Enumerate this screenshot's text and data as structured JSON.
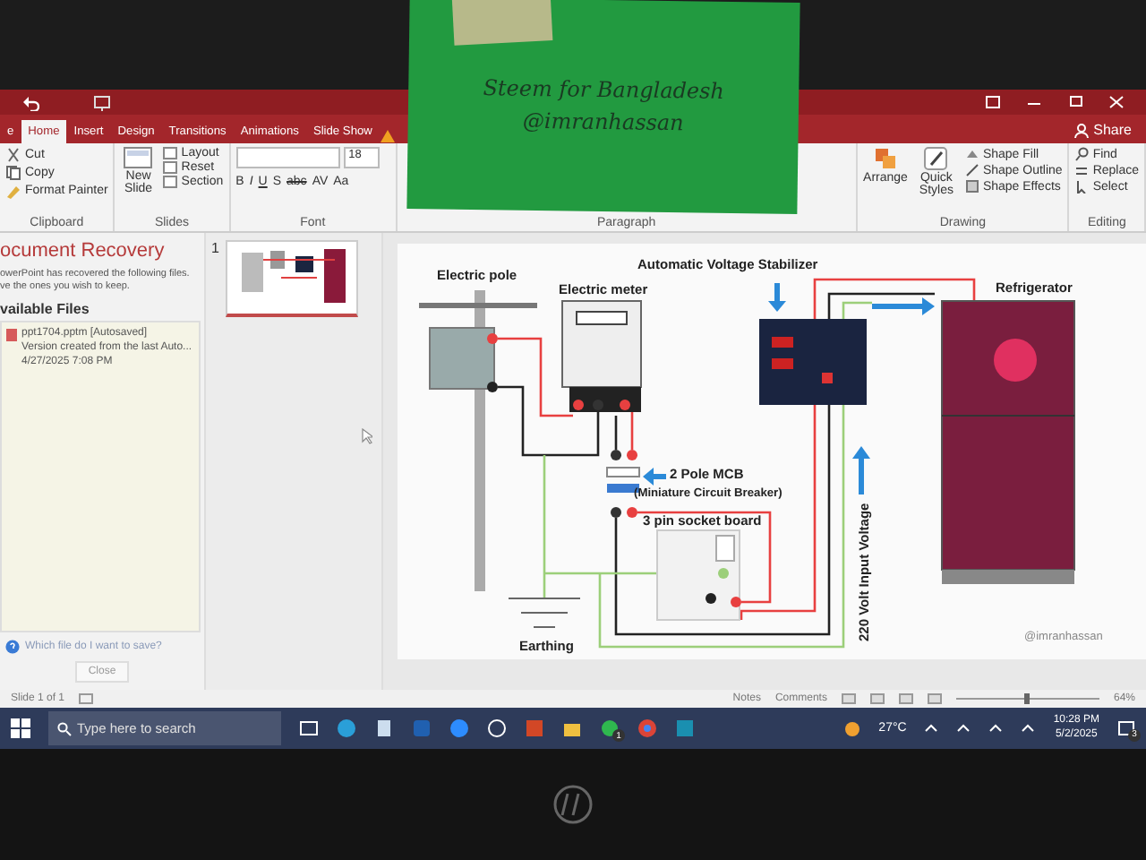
{
  "note": {
    "line_1": "Steem for Bangladesh",
    "line_2": "@imranhassan"
  },
  "ribbon": {
    "tabs": [
      {
        "label": "e",
        "selected": false
      },
      {
        "label": "Home",
        "selected": true
      },
      {
        "label": "Insert",
        "selected": false
      },
      {
        "label": "Design",
        "selected": false
      },
      {
        "label": "Transitions",
        "selected": false
      },
      {
        "label": "Animations",
        "selected": false
      },
      {
        "label": "Slide Show",
        "selected": false
      }
    ],
    "share": "Share",
    "clipboard": {
      "items": [
        "Cut",
        "Copy",
        "Format Painter"
      ],
      "label": "Clipboard"
    },
    "slides": {
      "new_slide": "New Slide",
      "items": [
        "Layout",
        "Reset",
        "Section"
      ],
      "label": "Slides"
    },
    "font": {
      "size": "18",
      "buttons": [
        "B",
        "I",
        "U",
        "S",
        "abc",
        "AV",
        "Aa"
      ],
      "label": "Font"
    },
    "paragraph": {
      "label": "Paragraph"
    },
    "drawing": {
      "arrange": "Arrange",
      "quick_styles": "Quick Styles",
      "items": [
        "Shape Fill",
        "Shape Outline",
        "Shape Effects"
      ],
      "label": "Drawing"
    },
    "editing": {
      "items": [
        "Find",
        "Replace",
        "Select"
      ],
      "label": "Editing"
    }
  },
  "recovery": {
    "title": "ocument Recovery",
    "message": [
      "owerPoint has recovered the following files.",
      "ve the ones you wish to keep."
    ],
    "heading": "vailable Files",
    "files": [
      {
        "name": "ppt1704.pptm  [Autosaved]",
        "detail": "Version created from the last Auto...",
        "date": "4/27/2025 7:08 PM"
      }
    ],
    "help_link": "Which file do I want to save?",
    "close": "Close"
  },
  "thumbnails": [
    {
      "number": "1",
      "selected": true
    }
  ],
  "slide": {
    "pole_label": "Electric pole",
    "meter_label": "Electric meter",
    "stabilizer_label": "Automatic Voltage Stabilizer",
    "refrigerator_label": "Refrigerator",
    "mcb_label": "2 Pole MCB",
    "mcb_note": "(Miniature Circuit Breaker)",
    "socket_label": "3 pin socket board",
    "earthing_label": "Earthing",
    "input_voltage_label": "220 Volt Input Voltage",
    "credit": "@imranhassan"
  },
  "status_bar": {
    "slide_count": "Slide 1 of 1",
    "notes": "Notes",
    "comments": "Comments",
    "zoom": "64%"
  },
  "taskbar": {
    "search_placeholder": "Type here to search",
    "whatsapp_badge": "1",
    "temperature": "27°C",
    "time": "10:28 PM",
    "date": "5/2/2025",
    "notification_count": "3"
  }
}
